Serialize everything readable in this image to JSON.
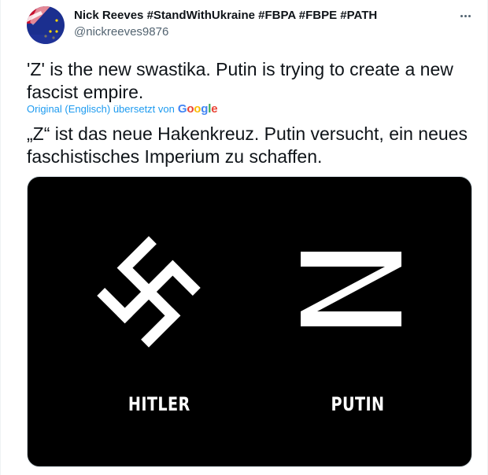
{
  "tweet": {
    "author_name": "Nick Reeves #StandWithUkraine #FBPA #FBPE #PATH",
    "author_handle": "@nickreeves9876",
    "text": "'Z' is the new swastika. Putin is trying to create a new fascist empire.",
    "translation_note": "Original (Englisch) übersetzt von",
    "translation_provider": "Google",
    "translated_text": "„Z“ ist das neue Hakenkreuz. Putin versucht, ein neues faschistisches Imperium zu schaffen.",
    "more_icon": "more-dots-icon"
  },
  "media": {
    "left_label": "HITLER",
    "right_label": "PUTIN",
    "background": "#000000",
    "symbol_color": "#ffffff"
  },
  "colors": {
    "link": "#1d9bf0",
    "secondary_text": "#536471",
    "primary_text": "#0f1419"
  }
}
